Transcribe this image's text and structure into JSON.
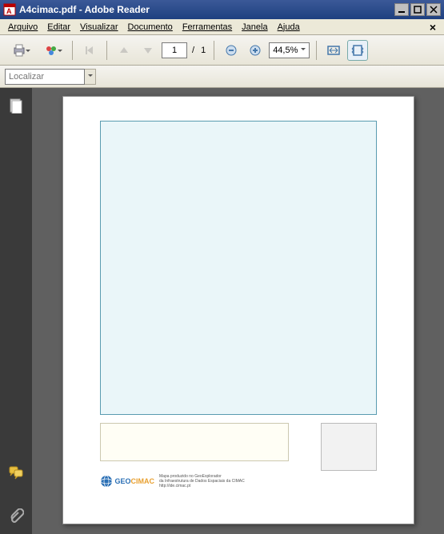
{
  "titlebar": {
    "filename": "A4cimac.pdf",
    "app": "Adobe Reader"
  },
  "menu": {
    "arquivo": "Arquivo",
    "editar": "Editar",
    "visualizar": "Visualizar",
    "documento": "Documento",
    "ferramentas": "Ferramentas",
    "janela": "Janela",
    "ajuda": "Ajuda"
  },
  "toolbar": {
    "current_page": "1",
    "page_sep": "/",
    "total_pages": "1",
    "zoom": "44,5%"
  },
  "findbar": {
    "placeholder": "Localizar"
  },
  "document": {
    "logo_geo": "GEO",
    "logo_cimac": "CIMAC",
    "logo_sub": "",
    "footer_line1": "Mapa produzido no GeoExplorador",
    "footer_line2": "da Infraestrutura de Dados Espaciais da CIMAC",
    "footer_url": "http://ide.cimac.pt"
  }
}
